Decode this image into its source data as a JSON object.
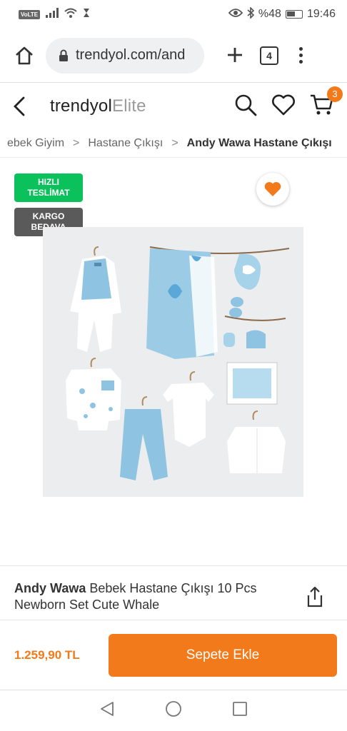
{
  "status_bar": {
    "volte": "VoLTE",
    "battery": "%48",
    "time": "19:46"
  },
  "browser": {
    "url": "trendyol.com/and",
    "tab_count": "4"
  },
  "site": {
    "logo_main": "trendyol",
    "logo_suffix": "Elite",
    "cart_count": "3"
  },
  "breadcrumb": {
    "items": [
      "ebek Giyim",
      "Hastane Çıkışı",
      "Andy Wawa Hastane Çıkışı"
    ],
    "separator": ">"
  },
  "product": {
    "badges": {
      "fast_line1": "HIZLI",
      "fast_line2": "TESLİMAT",
      "cargo_line1": "KARGO",
      "cargo_line2": "BEDAVA"
    },
    "brand": "Andy Wawa",
    "name": " Bebek Hastane Çıkışı 10 Pcs Newborn Set Cute Whale",
    "price": "1.259,90 TL",
    "add_to_cart": "Sepete Ekle"
  },
  "colors": {
    "accent": "#f27a1a",
    "badge_green": "#0bc15c",
    "badge_gray": "#5a5a5a"
  }
}
